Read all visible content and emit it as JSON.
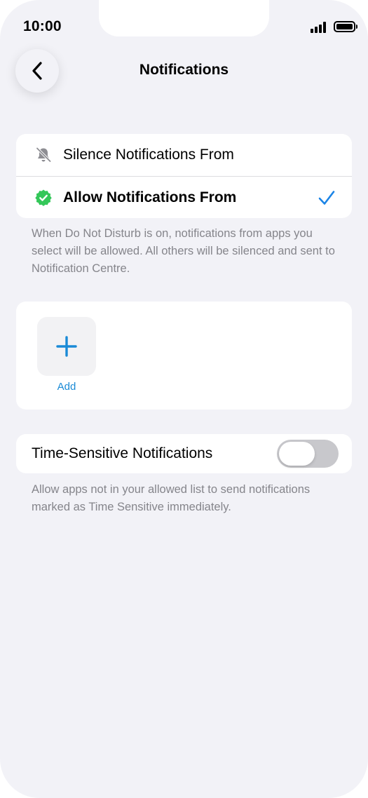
{
  "status_bar": {
    "time": "10:00",
    "signal_icon": "signal-bars-icon",
    "battery_icon": "battery-icon"
  },
  "header": {
    "title": "Notifications",
    "back_icon": "chevron-left-icon"
  },
  "mode_options": [
    {
      "label": "Silence Notifications From",
      "icon": "bell-slash-icon",
      "selected": false
    },
    {
      "label": "Allow Notifications From",
      "icon": "checkmark-seal-icon",
      "selected": true
    }
  ],
  "mode_footnote": "When Do Not Disturb is on, notifications from apps you select will be allowed. All others will be silenced and sent to Notification Centre.",
  "apps": {
    "add_label": "Add",
    "add_icon": "plus-icon"
  },
  "time_sensitive": {
    "label": "Time-Sensitive Notifications",
    "enabled": false,
    "footnote": "Allow apps not in your allowed list to send notifications marked as Time Sensitive immediately."
  },
  "colors": {
    "background": "#f2f2f7",
    "accent": "#1a8ad6",
    "checkmark": "#1b84e6",
    "seal_green": "#34c759",
    "toggle_off": "#c8c8cc",
    "footnote": "#85858b"
  }
}
